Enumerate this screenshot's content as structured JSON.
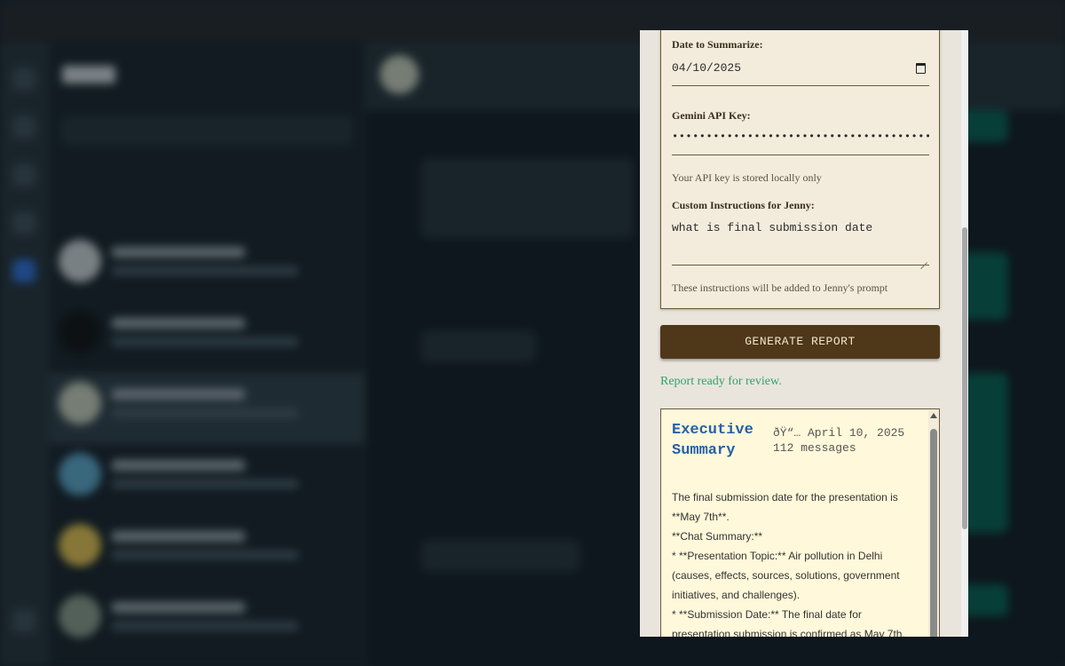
{
  "form": {
    "date_label": "Date to Summarize:",
    "date_value": "04/10/2025",
    "api_key_label": "Gemini API Key:",
    "api_key_value": "••••••••••••••••••••••••••••••••••••••••",
    "api_key_hint": "Your API key is stored locally only",
    "instructions_label": "Custom Instructions for Jenny:",
    "instructions_value": "what is final submission date",
    "instructions_hint": "These instructions will be added to Jenny's prompt"
  },
  "generate_button_label": "GENERATE REPORT",
  "status_text": "Report ready for review.",
  "report": {
    "title": "Executive Summary",
    "date_line": "ðŸ“… April 10, 2025",
    "messages_line": "112 messages",
    "body": [
      "The final submission date for the presentation is **May 7th**.",
      "**Chat Summary:**",
      "* **Presentation Topic:** Air pollution in Delhi (causes, effects, sources, solutions, government initiatives, and challenges).",
      "* **Submission Date:** The final date for presentation submission is confirmed as May 7th."
    ]
  },
  "colors": {
    "panel_bg": "#e9e5dc",
    "card_bg": "#f3ecdd",
    "button_bg": "#4e3819",
    "status_green": "#2fa36b",
    "report_bg": "#fff8da",
    "report_title": "#2560a8"
  },
  "icons": {
    "calendar": "calendar-icon",
    "resize": "resize-handle-icon",
    "scroll_up": "scroll-up-arrow-icon"
  }
}
